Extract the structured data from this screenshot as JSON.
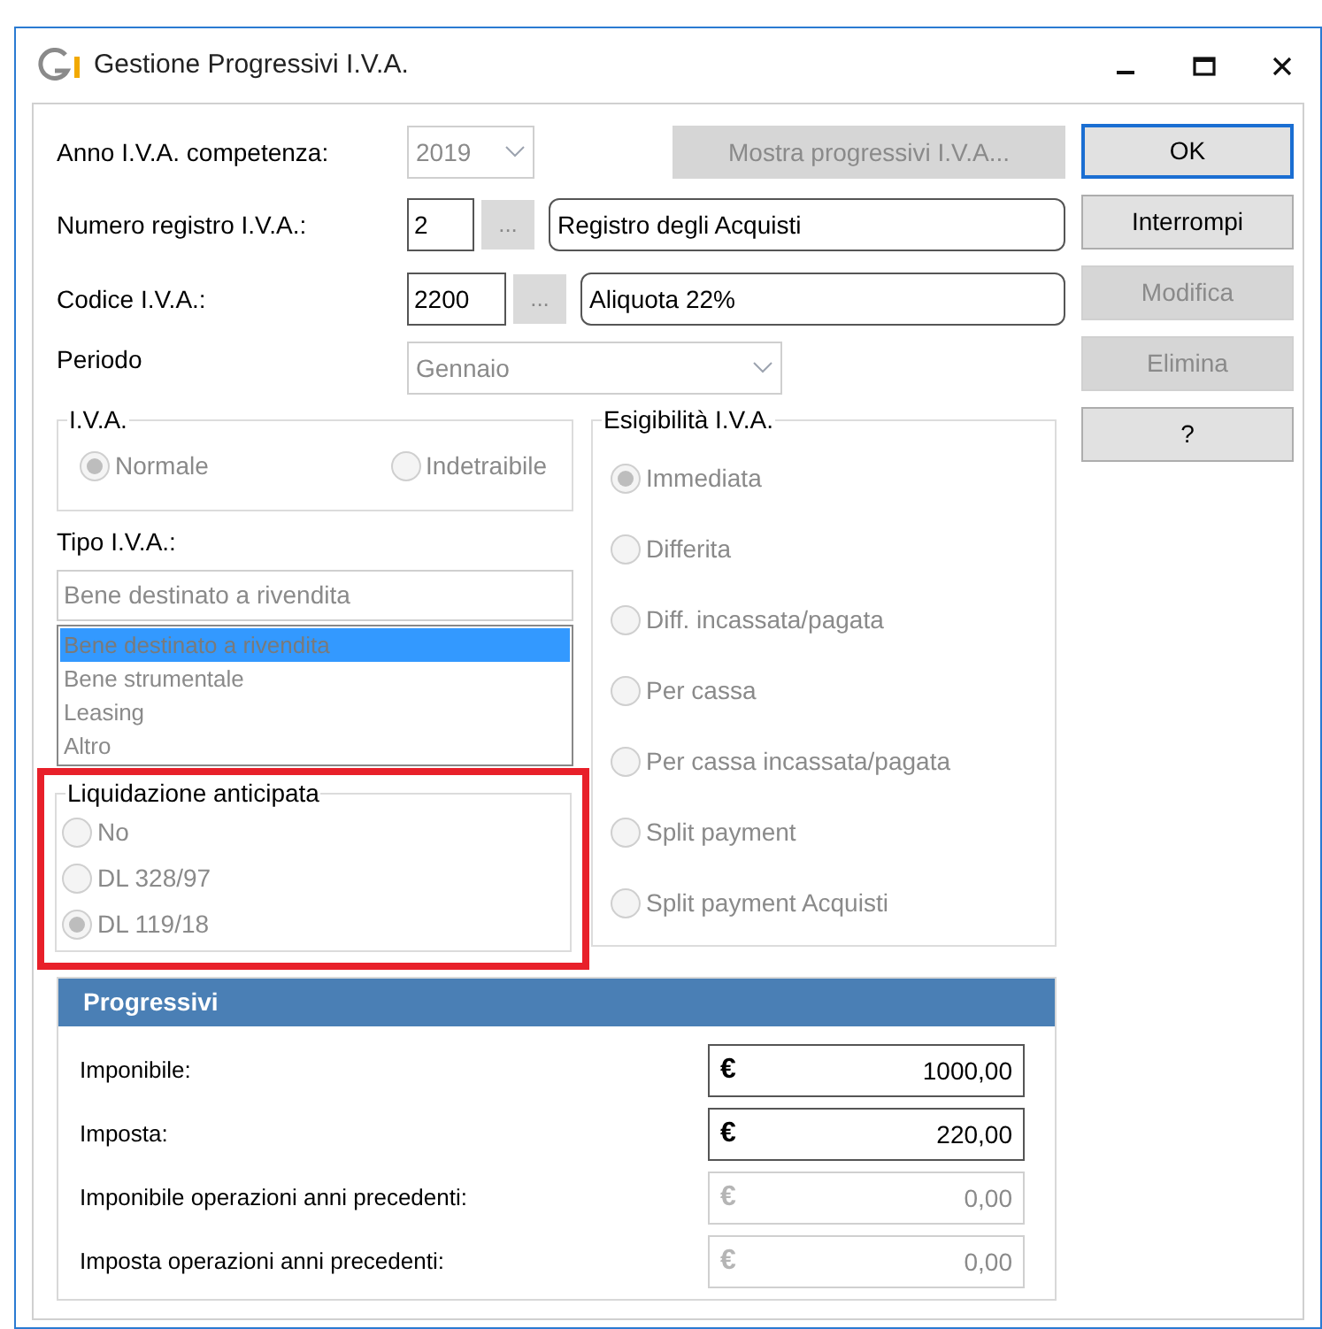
{
  "window": {
    "title": "Gestione Progressivi I.V.A."
  },
  "anno": {
    "label": "Anno I.V.A. competenza:",
    "value": "2019",
    "disabled": true
  },
  "show_button": {
    "label": "Mostra progressivi I.V.A...",
    "disabled": true
  },
  "registro": {
    "label": "Numero registro I.V.A.:",
    "code": "2",
    "lookup": "...",
    "description": "Registro degli Acquisti"
  },
  "codice": {
    "label": "Codice I.V.A.:",
    "code": "2200",
    "lookup": "...",
    "description": "Aliquota 22%"
  },
  "periodo": {
    "label": "Periodo",
    "value": "Gennaio",
    "disabled": true
  },
  "iva_group": {
    "title": "I.V.A.",
    "disabled": true,
    "options": [
      {
        "label": "Normale",
        "selected": true
      },
      {
        "label": "Indetraibile",
        "selected": false
      }
    ]
  },
  "tipo": {
    "label": "Tipo I.V.A.:",
    "value": "Bene destinato a rivendita",
    "disabled": true,
    "items": [
      {
        "label": "Bene destinato a rivendita",
        "selected": true
      },
      {
        "label": "Bene strumentale",
        "selected": false
      },
      {
        "label": "Leasing",
        "selected": false
      },
      {
        "label": "Altro",
        "selected": false
      }
    ]
  },
  "liquidazione": {
    "title": "Liquidazione anticipata",
    "highlighted": true,
    "disabled": true,
    "options": [
      {
        "label": "No",
        "selected": false
      },
      {
        "label": "DL 328/97",
        "selected": false
      },
      {
        "label": "DL 119/18",
        "selected": true
      }
    ]
  },
  "esigibilita": {
    "title": "Esigibilità I.V.A.",
    "disabled": true,
    "options": [
      {
        "label": "Immediata",
        "selected": true
      },
      {
        "label": "Differita",
        "selected": false
      },
      {
        "label": "Diff. incassata/pagata",
        "selected": false
      },
      {
        "label": "Per cassa",
        "selected": false
      },
      {
        "label": "Per cassa incassata/pagata",
        "selected": false
      },
      {
        "label": "Split payment",
        "selected": false
      },
      {
        "label": "Split payment Acquisti",
        "selected": false
      }
    ]
  },
  "progressivi": {
    "title": "Progressivi",
    "rows": [
      {
        "label": "Imponibile:",
        "currency": "€",
        "value": "1000,00",
        "disabled": false
      },
      {
        "label": "Imposta:",
        "currency": "€",
        "value": "220,00",
        "disabled": false
      },
      {
        "label": "Imponibile operazioni anni precedenti:",
        "currency": "€",
        "value": "0,00",
        "disabled": true
      },
      {
        "label": "Imposta operazioni anni precedenti:",
        "currency": "€",
        "value": "0,00",
        "disabled": true
      }
    ]
  },
  "buttons": [
    {
      "label": "OK",
      "default": true,
      "disabled": false
    },
    {
      "label": "Interrompi",
      "default": false,
      "disabled": false
    },
    {
      "label": "Modifica",
      "default": false,
      "disabled": true
    },
    {
      "label": "Elimina",
      "default": false,
      "disabled": true
    },
    {
      "label": "?",
      "default": false,
      "disabled": false
    }
  ]
}
